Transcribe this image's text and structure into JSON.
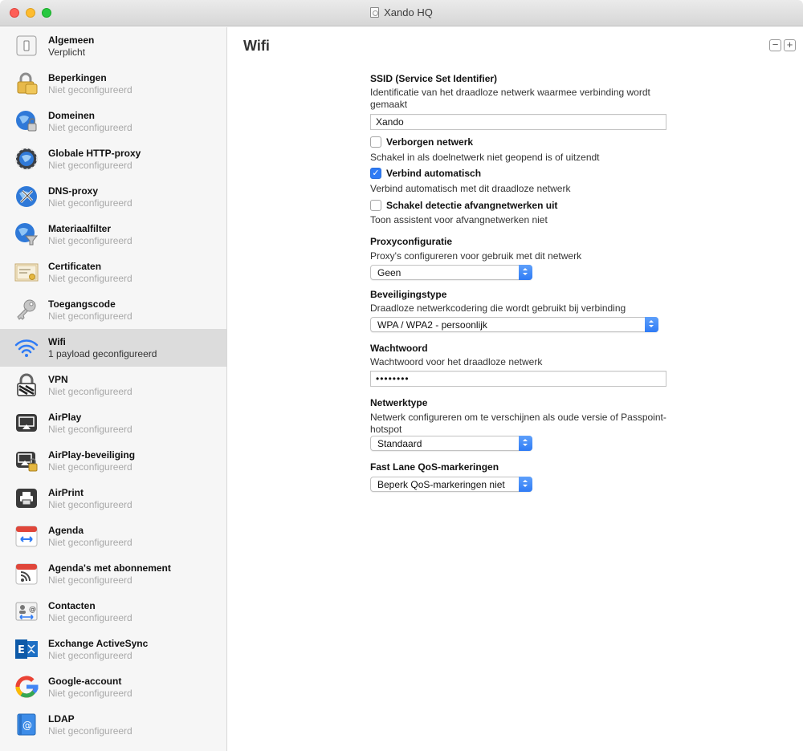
{
  "window": {
    "title": "Xando HQ"
  },
  "sidebar": {
    "items": [
      {
        "name": "Algemeen",
        "status": "Verplicht",
        "icon": "general-icon"
      },
      {
        "name": "Beperkingen",
        "status": "Niet geconfigureerd",
        "icon": "restrictions-icon"
      },
      {
        "name": "Domeinen",
        "status": "Niet geconfigureerd",
        "icon": "domains-icon"
      },
      {
        "name": "Globale HTTP-proxy",
        "status": "Niet geconfigureerd",
        "icon": "http-proxy-icon"
      },
      {
        "name": "DNS-proxy",
        "status": "Niet geconfigureerd",
        "icon": "dns-proxy-icon"
      },
      {
        "name": "Materiaalfilter",
        "status": "Niet geconfigureerd",
        "icon": "content-filter-icon"
      },
      {
        "name": "Certificaten",
        "status": "Niet geconfigureerd",
        "icon": "certificate-icon"
      },
      {
        "name": "Toegangscode",
        "status": "Niet geconfigureerd",
        "icon": "passcode-icon"
      },
      {
        "name": "Wifi",
        "status": "1 payload geconfigureerd",
        "icon": "wifi-icon"
      },
      {
        "name": "VPN",
        "status": "Niet geconfigureerd",
        "icon": "vpn-icon"
      },
      {
        "name": "AirPlay",
        "status": "Niet geconfigureerd",
        "icon": "airplay-icon"
      },
      {
        "name": "AirPlay-beveiliging",
        "status": "Niet geconfigureerd",
        "icon": "airplay-security-icon"
      },
      {
        "name": "AirPrint",
        "status": "Niet geconfigureerd",
        "icon": "airprint-icon"
      },
      {
        "name": "Agenda",
        "status": "Niet geconfigureerd",
        "icon": "calendar-icon"
      },
      {
        "name": "Agenda's met abonnement",
        "status": "Niet geconfigureerd",
        "icon": "subscribed-calendar-icon"
      },
      {
        "name": "Contacten",
        "status": "Niet geconfigureerd",
        "icon": "contacts-icon"
      },
      {
        "name": "Exchange ActiveSync",
        "status": "Niet geconfigureerd",
        "icon": "exchange-icon"
      },
      {
        "name": "Google-account",
        "status": "Niet geconfigureerd",
        "icon": "google-icon"
      },
      {
        "name": "LDAP",
        "status": "Niet geconfigureerd",
        "icon": "ldap-icon"
      }
    ],
    "selected": "Wifi"
  },
  "main": {
    "title": "Wifi",
    "ssid": {
      "label": "SSID (Service Set Identifier)",
      "description": "Identificatie van het draadloze netwerk waarmee verbinding wordt gemaakt",
      "value": "Xando"
    },
    "hidden_network": {
      "label": "Verborgen netwerk",
      "description": "Schakel in als doelnetwerk niet geopend is of uitzendt",
      "checked": false
    },
    "auto_join": {
      "label": "Verbind automatisch",
      "description": "Verbind automatisch met dit draadloze netwerk",
      "checked": true
    },
    "captive": {
      "label": "Schakel detectie afvangnetwerken uit",
      "description": "Toon assistent voor afvangnetwerken niet",
      "checked": false
    },
    "proxy": {
      "label": "Proxyconfiguratie",
      "description": "Proxy's configureren voor gebruik met dit netwerk",
      "value": "Geen"
    },
    "security": {
      "label": "Beveiligingstype",
      "description": "Draadloze netwerkcodering die wordt gebruikt bij verbinding",
      "value": "WPA / WPA2 - persoonlijk"
    },
    "password": {
      "label": "Wachtwoord",
      "description": "Wachtwoord voor het draadloze netwerk",
      "value": "••••••••"
    },
    "network_type": {
      "label": "Netwerktype",
      "description": "Netwerk configureren om te verschijnen als oude versie of Passpoint-hotspot",
      "value": "Standaard"
    },
    "qos": {
      "label": "Fast Lane QoS-markeringen",
      "value": "Beperk QoS-markeringen niet"
    }
  },
  "colors": {
    "accent": "#2f7bf5",
    "selection": "#dcdcdc",
    "muted": "#a8a8a8"
  }
}
